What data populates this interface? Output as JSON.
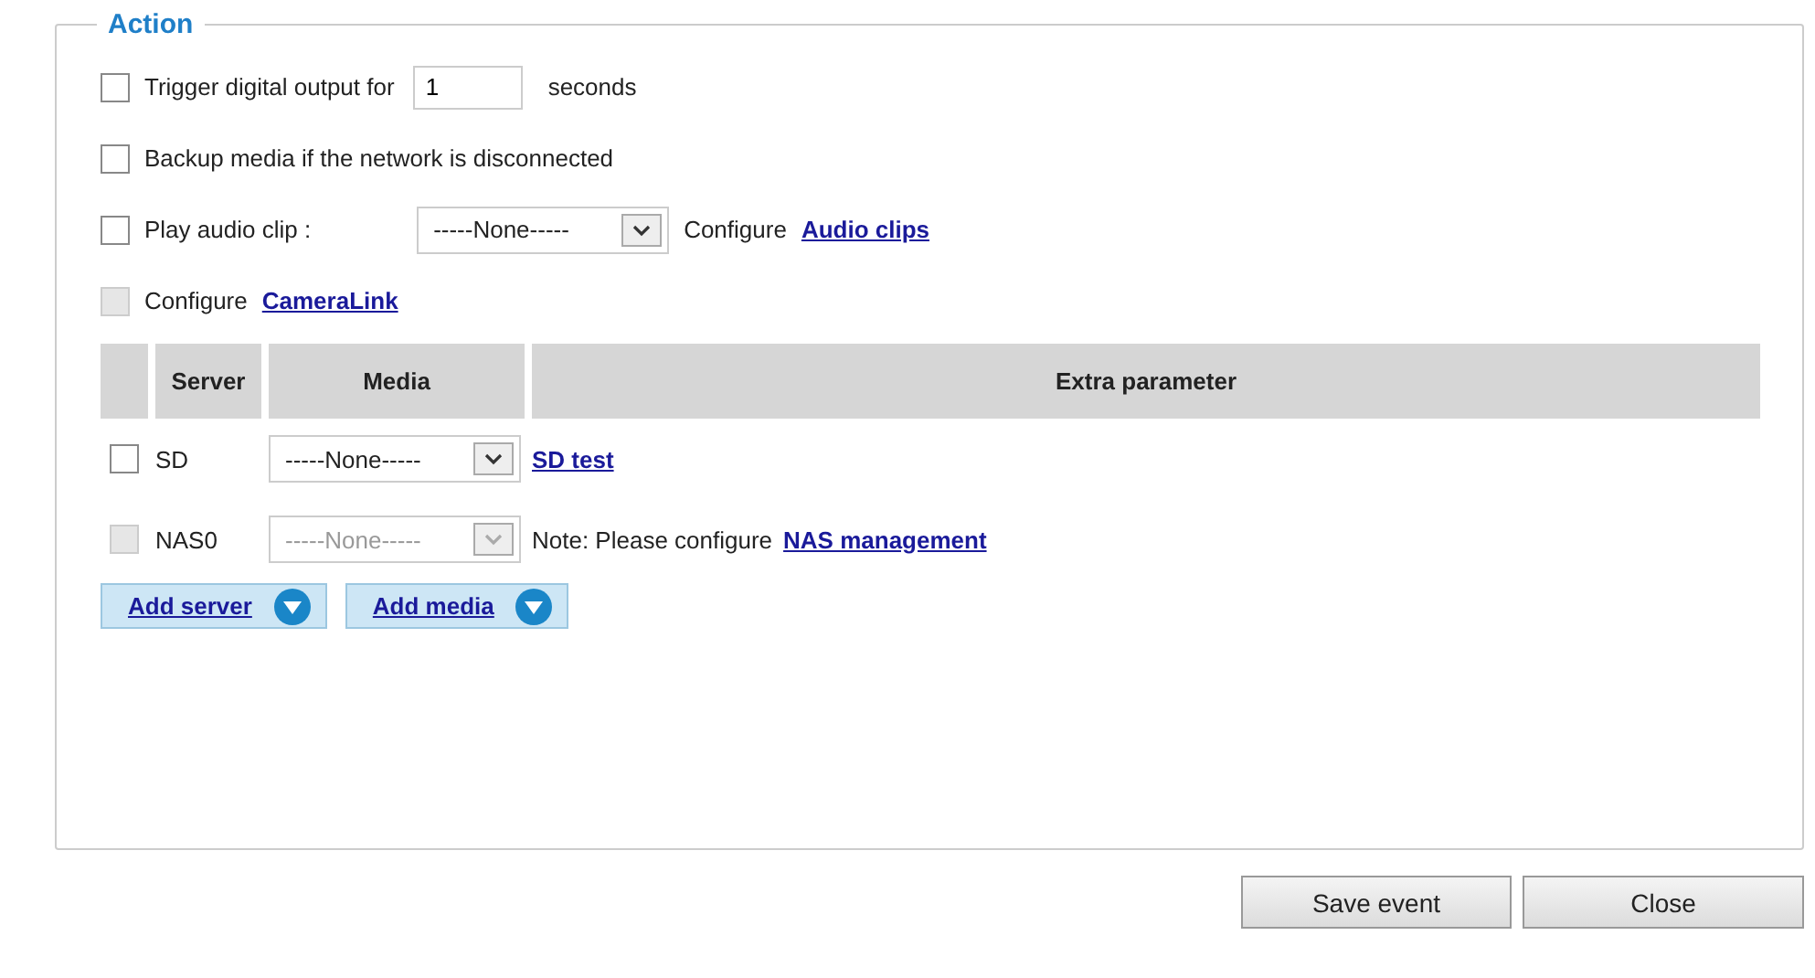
{
  "section": {
    "title": "Action"
  },
  "options": [
    {
      "kind": "input",
      "label": "Trigger digital output for",
      "checked": false,
      "disabled": false,
      "value": "1",
      "suffix": "seconds"
    },
    {
      "kind": "plain",
      "label": "Backup media if the network is disconnected",
      "checked": false,
      "disabled": false
    },
    {
      "kind": "select",
      "label": "Play audio clip :",
      "checked": false,
      "disabled": false,
      "select": "-----None-----",
      "note": "Configure",
      "link": "Audio clips"
    },
    {
      "kind": "link",
      "label": "Configure",
      "checked": false,
      "disabled": true,
      "link": "CameraLink"
    }
  ],
  "table": {
    "columns": [
      "Server",
      "Media",
      "Extra parameter"
    ],
    "rows": [
      {
        "server": "SD",
        "checked": false,
        "disabled": false,
        "media": "-----None-----",
        "note": "",
        "link": "SD test"
      },
      {
        "server": "NAS0",
        "checked": false,
        "disabled": true,
        "media": "-----None-----",
        "note": "Note: Please configure",
        "link": "NAS management"
      }
    ]
  },
  "add_buttons": [
    "Add server",
    "Add media"
  ],
  "buttons": [
    "Save event",
    "Close"
  ]
}
